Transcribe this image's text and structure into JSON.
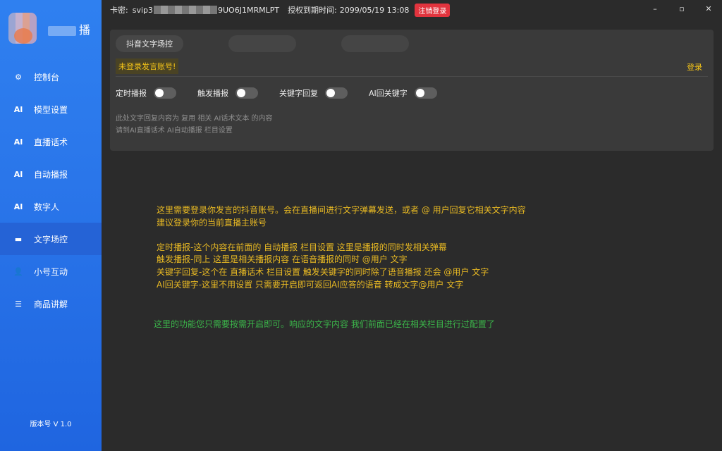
{
  "sidebar": {
    "brand_name": "播",
    "items": [
      {
        "icon": "gear-icon",
        "glyph": "⚙",
        "label": "控制台"
      },
      {
        "icon": "ai-icon",
        "glyph": "AI",
        "label": "模型设置"
      },
      {
        "icon": "ai-icon",
        "glyph": "AI",
        "label": "直播话术"
      },
      {
        "icon": "ai-icon",
        "glyph": "AI",
        "label": "自动播报"
      },
      {
        "icon": "ai-icon",
        "glyph": "AI",
        "label": "数字人"
      },
      {
        "icon": "chat-icon",
        "glyph": "▬",
        "label": "文字场控",
        "active": true
      },
      {
        "icon": "add-user-icon",
        "glyph": "👤",
        "label": "小号互动"
      },
      {
        "icon": "list-icon",
        "glyph": "☰",
        "label": "商品讲解"
      }
    ],
    "version": "版本号 V 1.0"
  },
  "topbar": {
    "card_label": "卡密:",
    "card_prefix": "svip3",
    "card_suffix": "9UO6J1MRMLPT",
    "expire_label": "授权到期时间:",
    "expire_value": "2099/05/19 13:08",
    "logout_label": "注销登录",
    "min": "–",
    "max": "▫",
    "close": "✕"
  },
  "panel": {
    "tabs": [
      "抖音文字场控",
      "",
      ""
    ],
    "warning": "未登录发言账号!",
    "login": "登录",
    "toggles": [
      {
        "label": "定时播报",
        "on": false
      },
      {
        "label": "触发播报",
        "on": false
      },
      {
        "label": "关键字回复",
        "on": false
      },
      {
        "label": "AI回关键字",
        "on": false
      }
    ],
    "hint1": "此处文字回复内容为 复用 相关 AI话术文本 的内容",
    "hint2": "请到AI直播话术 AI自动播报 栏目设置"
  },
  "notes": {
    "line1": "这里需要登录你发言的抖音账号。会在直播间进行文字弹幕发送，或者 @ 用户回复它相关文字内容",
    "line2": "建议登录你的当前直播主账号",
    "line3": "定时播报-这个内容在前面的 自动播报 栏目设置     这里是播报的同时发相关弹幕",
    "line4": "触发播报-同上 这里是相关播报内容 在语音播报的同时 @用户 文字",
    "line5": "关键字回复-这个在 直播话术 栏目设置  触发关键字的同时除了语音播报 还会 @用户 文字",
    "line6": "AI回关键字-这里不用设置 只需要开启即可返回AI应答的语音 转成文字@用户 文字",
    "green": "这里的功能您只需要按需开启即可。响应的文字内容 我们前面已经在相关栏目进行过配置了"
  },
  "colors": {
    "sidebar": "#2f80f0",
    "background": "#2b2b2b",
    "panel": "#3a3a3a",
    "notes": "#e8b923",
    "green": "#3bb54a",
    "logout": "#e2343e"
  }
}
